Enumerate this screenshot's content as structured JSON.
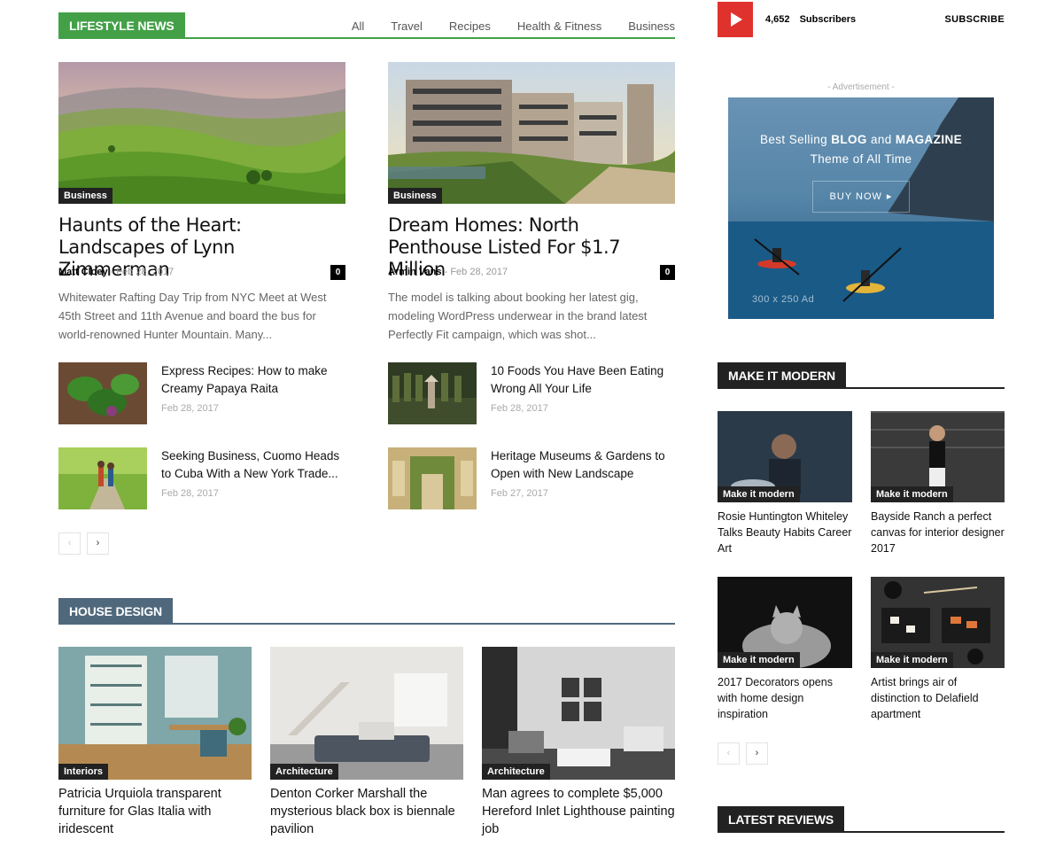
{
  "lifestyle": {
    "header": "LIFESTYLE NEWS",
    "filters": [
      "All",
      "Travel",
      "Recipes",
      "Health & Fitness",
      "Business"
    ],
    "featured": [
      {
        "category": "Business",
        "title": "Haunts of the Heart: Landscapes of Lynn Zimmerman",
        "author": "Matt Cloey",
        "date": "Feb 28, 2017",
        "comments": "0",
        "excerpt": "Whitewater Rafting Day Trip from NYC Meet at West 45th Street and 11th Avenue and board the bus for world-renowned Hunter Mountain. Many..."
      },
      {
        "category": "Business",
        "title": "Dream Homes: North Penthouse Listed For $1.7 Million",
        "author": "Armin Vans",
        "date": "Feb 28, 2017",
        "comments": "0",
        "excerpt": "The model is talking about booking her latest gig, modeling WordPress underwear in the brand latest Perfectly Fit campaign, which was shot..."
      }
    ],
    "small": [
      {
        "title": "Express Recipes: How to make Creamy Papaya Raita",
        "date": "Feb 28, 2017"
      },
      {
        "title": "10 Foods You Have Been Eating Wrong All Your Life",
        "date": "Feb 28, 2017"
      },
      {
        "title": "Seeking Business, Cuomo Heads to Cuba With a New York Trade...",
        "date": "Feb 28, 2017"
      },
      {
        "title": "Heritage Museums & Gardens to Open with New Landscape",
        "date": "Feb 27, 2017"
      }
    ],
    "pager": {
      "prev": "‹",
      "next": "›"
    }
  },
  "house": {
    "header": "HOUSE DESIGN",
    "items": [
      {
        "category": "Interiors",
        "title": "Patricia Urquiola transparent furniture for Glas Italia with iridescent"
      },
      {
        "category": "Architecture",
        "title": "Denton Corker Marshall the mysterious black box is biennale pavilion"
      },
      {
        "category": "Architecture",
        "title": "Man agrees to complete $5,000 Hereford Inlet Lighthouse painting job"
      }
    ]
  },
  "sidebar": {
    "subscribers": "4,652",
    "subscribers_label": "Subscribers",
    "subscribe": "SUBSCRIBE",
    "ad_label": "- Advertisement -",
    "ad": {
      "line1_a": "Best Selling ",
      "line1_b": "BLOG",
      "line1_c": " and ",
      "line1_d": "MAGAZINE",
      "line2": "Theme of All Time",
      "button": "BUY NOW",
      "size": "300 x 250 Ad"
    },
    "modern": {
      "header": "MAKE IT MODERN",
      "items": [
        {
          "category": "Make it modern",
          "title": "Rosie Huntington Whiteley Talks Beauty Habits Career Art"
        },
        {
          "category": "Make it modern",
          "title": "Bayside Ranch a perfect canvas for interior designer 2017"
        },
        {
          "category": "Make it modern",
          "title": "2017 Decorators opens with home design inspiration"
        },
        {
          "category": "Make it modern",
          "title": "Artist brings air of distinction to Delafield apartment"
        }
      ],
      "pager": {
        "prev": "‹",
        "next": "›"
      }
    },
    "reviews_header": "LATEST REVIEWS"
  },
  "colors": {
    "green": "#4db2ec",
    "lifestyle": "#43a047",
    "house": "#50687c",
    "dark": "#222222",
    "youtube": "#e0322d"
  }
}
